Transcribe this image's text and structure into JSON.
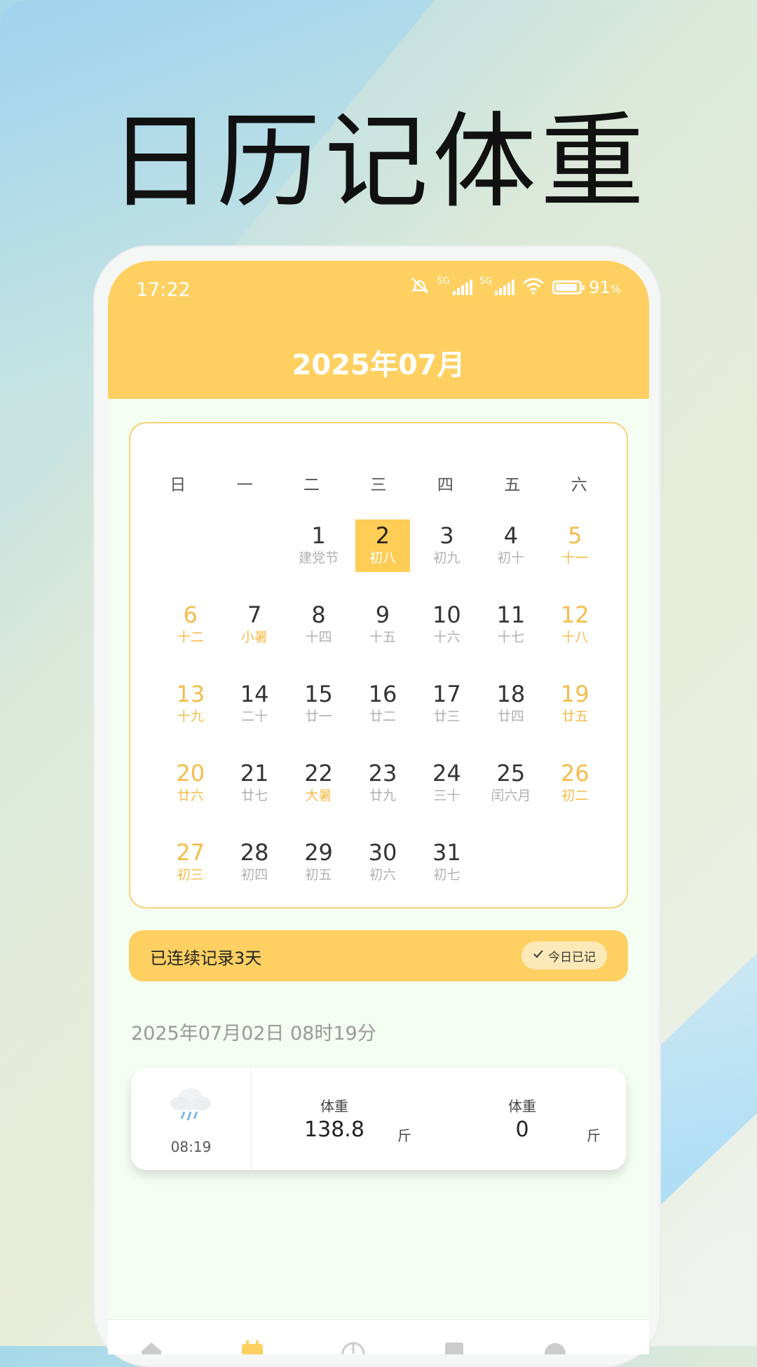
{
  "headline": "日历记体重",
  "status": {
    "time": "17:22",
    "net1": "5G",
    "net2": "5G",
    "battery": "91",
    "battery_unit": "%"
  },
  "header": {
    "month": "2025年07月"
  },
  "weekdays": [
    "日",
    "一",
    "二",
    "三",
    "四",
    "五",
    "六"
  ],
  "calendar": {
    "selected_day": "2",
    "weeks": [
      [
        {
          "d": "",
          "l": ""
        },
        {
          "d": "",
          "l": ""
        },
        {
          "d": "1",
          "l": "建党节"
        },
        {
          "d": "2",
          "l": "初八",
          "today": true
        },
        {
          "d": "3",
          "l": "初九"
        },
        {
          "d": "4",
          "l": "初十"
        },
        {
          "d": "5",
          "l": "十一"
        }
      ],
      [
        {
          "d": "6",
          "l": "十二"
        },
        {
          "d": "7",
          "l": "小暑",
          "term": true
        },
        {
          "d": "8",
          "l": "十四"
        },
        {
          "d": "9",
          "l": "十五"
        },
        {
          "d": "10",
          "l": "十六"
        },
        {
          "d": "11",
          "l": "十七"
        },
        {
          "d": "12",
          "l": "十八"
        }
      ],
      [
        {
          "d": "13",
          "l": "十九"
        },
        {
          "d": "14",
          "l": "二十"
        },
        {
          "d": "15",
          "l": "廿一"
        },
        {
          "d": "16",
          "l": "廿二"
        },
        {
          "d": "17",
          "l": "廿三"
        },
        {
          "d": "18",
          "l": "廿四"
        },
        {
          "d": "19",
          "l": "廿五"
        }
      ],
      [
        {
          "d": "20",
          "l": "廿六"
        },
        {
          "d": "21",
          "l": "廿七"
        },
        {
          "d": "22",
          "l": "大暑",
          "term": true
        },
        {
          "d": "23",
          "l": "廿九"
        },
        {
          "d": "24",
          "l": "三十"
        },
        {
          "d": "25",
          "l": "闰六月"
        },
        {
          "d": "26",
          "l": "初二"
        }
      ],
      [
        {
          "d": "27",
          "l": "初三"
        },
        {
          "d": "28",
          "l": "初四"
        },
        {
          "d": "29",
          "l": "初五"
        },
        {
          "d": "30",
          "l": "初六"
        },
        {
          "d": "31",
          "l": "初七"
        },
        {
          "d": "",
          "l": ""
        },
        {
          "d": "",
          "l": ""
        }
      ]
    ]
  },
  "streak": {
    "text": "已连续记录3天",
    "badge": "今日已记"
  },
  "record": {
    "datetime": "2025年07月02日 08时19分",
    "weather_icon": "rain-cloud-icon",
    "time": "08:19",
    "metric1": {
      "label": "体重",
      "value": "138.8",
      "unit": "斤"
    },
    "metric2": {
      "label": "体重",
      "value": "0",
      "unit": "斤"
    }
  },
  "colors": {
    "accent": "#fdd061",
    "weekend": "#f6bc4b",
    "screen_bg": "#f4fdf2"
  }
}
